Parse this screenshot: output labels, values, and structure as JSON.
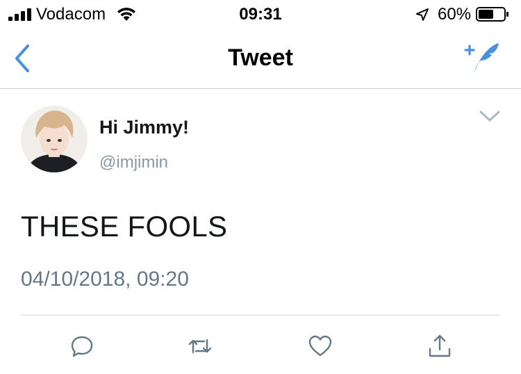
{
  "status_bar": {
    "carrier": "Vodacom",
    "time": "09:31",
    "battery_percent": "60%",
    "battery_level": 0.6,
    "icons": [
      "signal-icon",
      "wifi-icon",
      "location-arrow-icon",
      "battery-icon"
    ]
  },
  "nav": {
    "title": "Tweet",
    "back_icon": "chevron-left-icon",
    "compose_icon": "compose-tweet-icon",
    "accent_color": "#4a90e2"
  },
  "tweet": {
    "display_name": "Hi Jimmy!",
    "handle": "@imjimin",
    "text": "THESE FOOLS",
    "timestamp": "04/10/2018, 09:20",
    "menu_icon": "chevron-down-icon"
  },
  "actions": {
    "icons": [
      "reply-icon",
      "retweet-icon",
      "like-icon",
      "share-icon"
    ],
    "icon_color": "#657786"
  }
}
